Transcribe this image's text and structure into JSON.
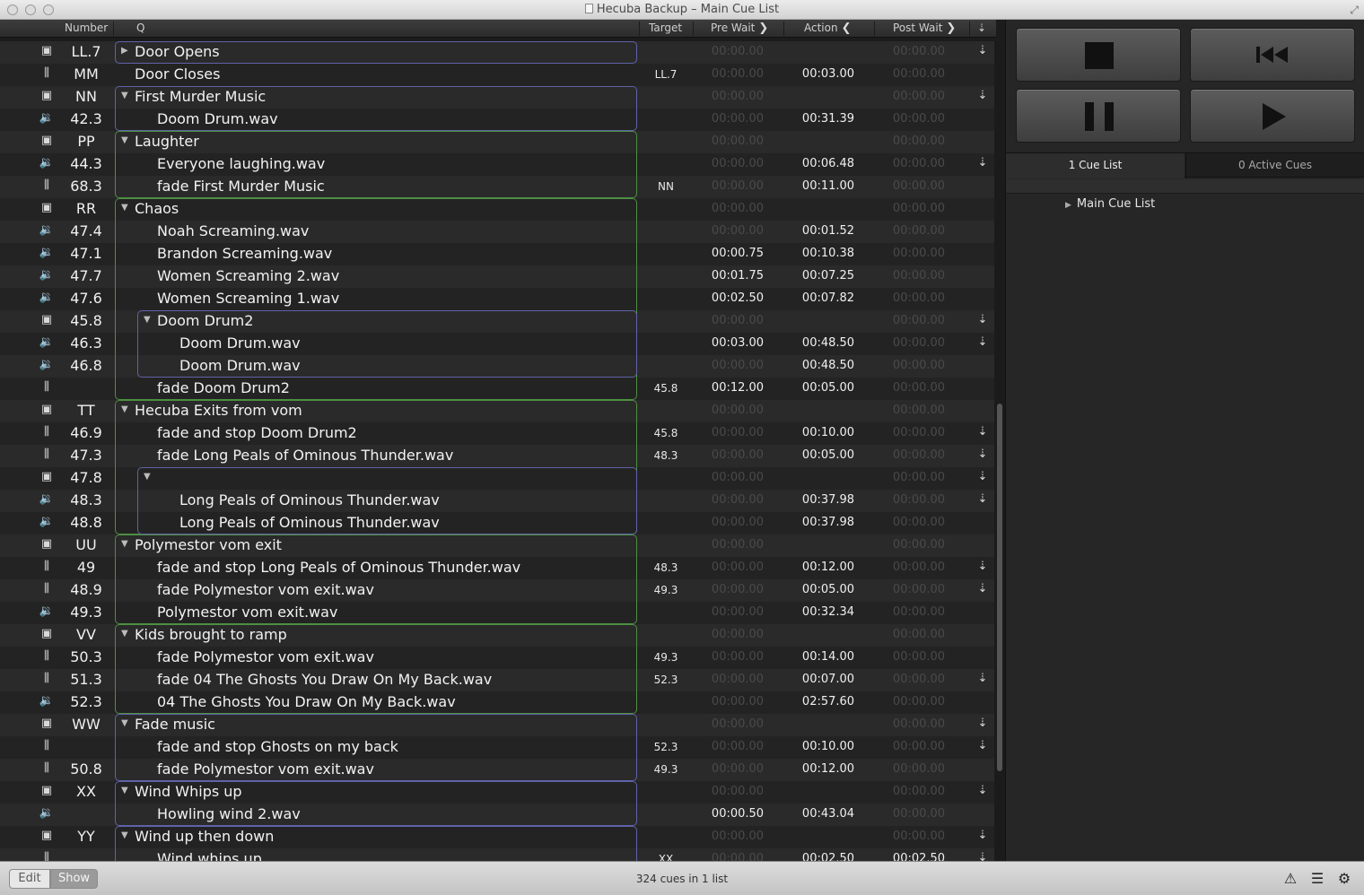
{
  "window": {
    "title": "Hecuba Backup – Main Cue List"
  },
  "columns": {
    "number": "Number",
    "q": "Q",
    "target": "Target",
    "pre_wait": "Pre Wait",
    "action": "Action",
    "post_wait": "Post Wait"
  },
  "rows": [
    {
      "type": "group",
      "num": "LL.7",
      "indent": 0,
      "tri": "collapsed",
      "name": "Door Opens",
      "target": "",
      "pre": "00:00.00",
      "pre_lit": false,
      "action": "",
      "post": "00:00.00",
      "cont": true
    },
    {
      "type": "fade",
      "num": "MM",
      "indent": 0,
      "tri": "",
      "name": "Door Closes",
      "target": "LL.7",
      "pre": "00:00.00",
      "pre_lit": false,
      "action": "00:03.00",
      "post": "00:00.00",
      "cont": false
    },
    {
      "type": "group",
      "num": "NN",
      "indent": 0,
      "tri": "open",
      "name": "First Murder Music",
      "target": "",
      "pre": "00:00.00",
      "pre_lit": false,
      "action": "",
      "post": "00:00.00",
      "cont": true
    },
    {
      "type": "audio",
      "num": "42.3",
      "indent": 1,
      "tri": "",
      "name": "Doom Drum.wav",
      "target": "",
      "pre": "00:00.00",
      "pre_lit": false,
      "action": "00:31.39",
      "post": "00:00.00",
      "cont": false
    },
    {
      "type": "group",
      "num": "PP",
      "indent": 0,
      "tri": "open",
      "name": "Laughter",
      "target": "",
      "pre": "00:00.00",
      "pre_lit": false,
      "action": "",
      "post": "00:00.00",
      "cont": false
    },
    {
      "type": "audio",
      "num": "44.3",
      "indent": 1,
      "tri": "",
      "name": "Everyone laughing.wav",
      "target": "",
      "pre": "00:00.00",
      "pre_lit": false,
      "action": "00:06.48",
      "post": "00:00.00",
      "cont": true
    },
    {
      "type": "fade",
      "num": "68.3",
      "indent": 1,
      "tri": "",
      "name": "fade First Murder Music",
      "target": "NN",
      "pre": "00:00.00",
      "pre_lit": false,
      "action": "00:11.00",
      "post": "00:00.00",
      "cont": false
    },
    {
      "type": "group",
      "num": "RR",
      "indent": 0,
      "tri": "open",
      "name": "Chaos",
      "target": "",
      "pre": "00:00.00",
      "pre_lit": false,
      "action": "",
      "post": "00:00.00",
      "cont": false
    },
    {
      "type": "audio",
      "num": "47.4",
      "indent": 1,
      "tri": "",
      "name": "Noah Screaming.wav",
      "target": "",
      "pre": "00:00.00",
      "pre_lit": false,
      "action": "00:01.52",
      "post": "00:00.00",
      "cont": false
    },
    {
      "type": "audio",
      "num": "47.1",
      "indent": 1,
      "tri": "",
      "name": "Brandon Screaming.wav",
      "target": "",
      "pre": "00:00.75",
      "pre_lit": true,
      "action": "00:10.38",
      "post": "00:00.00",
      "cont": false
    },
    {
      "type": "audio",
      "num": "47.7",
      "indent": 1,
      "tri": "",
      "name": "Women Screaming 2.wav",
      "target": "",
      "pre": "00:01.75",
      "pre_lit": true,
      "action": "00:07.25",
      "post": "00:00.00",
      "cont": false
    },
    {
      "type": "audio",
      "num": "47.6",
      "indent": 1,
      "tri": "",
      "name": "Women Screaming 1.wav",
      "target": "",
      "pre": "00:02.50",
      "pre_lit": true,
      "action": "00:07.82",
      "post": "00:00.00",
      "cont": false
    },
    {
      "type": "group",
      "num": "45.8",
      "indent": 1,
      "tri": "open",
      "name": "Doom Drum2",
      "target": "",
      "pre": "00:00.00",
      "pre_lit": false,
      "action": "",
      "post": "00:00.00",
      "cont": true
    },
    {
      "type": "audio",
      "num": "46.3",
      "indent": 2,
      "tri": "",
      "name": "Doom Drum.wav",
      "target": "",
      "pre": "00:03.00",
      "pre_lit": true,
      "action": "00:48.50",
      "post": "00:00.00",
      "cont": true
    },
    {
      "type": "audio",
      "num": "46.8",
      "indent": 2,
      "tri": "",
      "name": "Doom Drum.wav",
      "target": "",
      "pre": "00:00.00",
      "pre_lit": false,
      "action": "00:48.50",
      "post": "00:00.00",
      "cont": false
    },
    {
      "type": "fade",
      "num": "",
      "indent": 1,
      "tri": "",
      "name": "fade Doom Drum2",
      "target": "45.8",
      "pre": "00:12.00",
      "pre_lit": true,
      "action": "00:05.00",
      "post": "00:00.00",
      "cont": false
    },
    {
      "type": "group",
      "num": "TT",
      "indent": 0,
      "tri": "open",
      "name": "Hecuba Exits from vom",
      "target": "",
      "pre": "00:00.00",
      "pre_lit": false,
      "action": "",
      "post": "00:00.00",
      "cont": false
    },
    {
      "type": "fade",
      "num": "46.9",
      "indent": 1,
      "tri": "",
      "name": "fade and stop Doom Drum2",
      "target": "45.8",
      "pre": "00:00.00",
      "pre_lit": false,
      "action": "00:10.00",
      "post": "00:00.00",
      "cont": true
    },
    {
      "type": "fade",
      "num": "47.3",
      "indent": 1,
      "tri": "",
      "name": "fade Long Peals of Ominous Thunder.wav",
      "target": "48.3",
      "pre": "00:00.00",
      "pre_lit": false,
      "action": "00:05.00",
      "post": "00:00.00",
      "cont": true
    },
    {
      "type": "group",
      "num": "47.8",
      "indent": 1,
      "tri": "open",
      "name": "",
      "target": "",
      "pre": "00:00.00",
      "pre_lit": false,
      "action": "",
      "post": "00:00.00",
      "cont": true
    },
    {
      "type": "audio",
      "num": "48.3",
      "indent": 2,
      "tri": "",
      "name": "Long Peals of Ominous Thunder.wav",
      "target": "",
      "pre": "00:00.00",
      "pre_lit": false,
      "action": "00:37.98",
      "post": "00:00.00",
      "cont": true
    },
    {
      "type": "audio",
      "num": "48.8",
      "indent": 2,
      "tri": "",
      "name": "Long Peals of Ominous Thunder.wav",
      "target": "",
      "pre": "00:00.00",
      "pre_lit": false,
      "action": "00:37.98",
      "post": "00:00.00",
      "cont": false
    },
    {
      "type": "group",
      "num": "UU",
      "indent": 0,
      "tri": "open",
      "name": "Polymestor vom exit",
      "target": "",
      "pre": "00:00.00",
      "pre_lit": false,
      "action": "",
      "post": "00:00.00",
      "cont": false
    },
    {
      "type": "fade",
      "num": "49",
      "indent": 1,
      "tri": "",
      "name": "fade and stop Long Peals of Ominous Thunder.wav",
      "target": "48.3",
      "pre": "00:00.00",
      "pre_lit": false,
      "action": "00:12.00",
      "post": "00:00.00",
      "cont": true
    },
    {
      "type": "fade",
      "num": "48.9",
      "indent": 1,
      "tri": "",
      "name": "fade Polymestor vom exit.wav",
      "target": "49.3",
      "pre": "00:00.00",
      "pre_lit": false,
      "action": "00:05.00",
      "post": "00:00.00",
      "cont": true
    },
    {
      "type": "audio",
      "num": "49.3",
      "indent": 1,
      "tri": "",
      "name": "Polymestor vom exit.wav",
      "target": "",
      "pre": "00:00.00",
      "pre_lit": false,
      "action": "00:32.34",
      "post": "00:00.00",
      "cont": false
    },
    {
      "type": "group",
      "num": "VV",
      "indent": 0,
      "tri": "open",
      "name": "Kids brought to ramp",
      "target": "",
      "pre": "00:00.00",
      "pre_lit": false,
      "action": "",
      "post": "00:00.00",
      "cont": false
    },
    {
      "type": "fade",
      "num": "50.3",
      "indent": 1,
      "tri": "",
      "name": "fade Polymestor vom exit.wav",
      "target": "49.3",
      "pre": "00:00.00",
      "pre_lit": false,
      "action": "00:14.00",
      "post": "00:00.00",
      "cont": false
    },
    {
      "type": "fade",
      "num": "51.3",
      "indent": 1,
      "tri": "",
      "name": "fade 04 The Ghosts You Draw On My Back.wav",
      "target": "52.3",
      "pre": "00:00.00",
      "pre_lit": false,
      "action": "00:07.00",
      "post": "00:00.00",
      "cont": true
    },
    {
      "type": "audio",
      "num": "52.3",
      "indent": 1,
      "tri": "",
      "name": "04 The Ghosts You Draw On My Back.wav",
      "target": "",
      "pre": "00:00.00",
      "pre_lit": false,
      "action": "02:57.60",
      "post": "00:00.00",
      "cont": false
    },
    {
      "type": "group",
      "num": "WW",
      "indent": 0,
      "tri": "open",
      "name": "Fade music",
      "target": "",
      "pre": "00:00.00",
      "pre_lit": false,
      "action": "",
      "post": "00:00.00",
      "cont": true
    },
    {
      "type": "fade",
      "num": "",
      "indent": 1,
      "tri": "",
      "name": "fade and stop Ghosts on my back",
      "target": "52.3",
      "pre": "00:00.00",
      "pre_lit": false,
      "action": "00:10.00",
      "post": "00:00.00",
      "cont": true
    },
    {
      "type": "fade",
      "num": "50.8",
      "indent": 1,
      "tri": "",
      "name": "fade Polymestor vom exit.wav",
      "target": "49.3",
      "pre": "00:00.00",
      "pre_lit": false,
      "action": "00:12.00",
      "post": "00:00.00",
      "cont": false
    },
    {
      "type": "group",
      "num": "XX",
      "indent": 0,
      "tri": "open",
      "name": "Wind Whips up",
      "target": "",
      "pre": "00:00.00",
      "pre_lit": false,
      "action": "",
      "post": "00:00.00",
      "cont": true
    },
    {
      "type": "audio",
      "num": "",
      "indent": 1,
      "tri": "",
      "name": "Howling wind 2.wav",
      "target": "",
      "pre": "00:00.50",
      "pre_lit": true,
      "action": "00:43.04",
      "post": "00:00.00",
      "cont": false
    },
    {
      "type": "group",
      "num": "YY",
      "indent": 0,
      "tri": "open",
      "name": "Wind up then down",
      "target": "",
      "pre": "00:00.00",
      "pre_lit": false,
      "action": "",
      "post": "00:00.00",
      "cont": true
    },
    {
      "type": "fade",
      "num": "",
      "indent": 1,
      "tri": "",
      "name": "Wind whips up",
      "target": "XX",
      "pre": "00:00.00",
      "pre_lit": false,
      "action": "00:02.50",
      "post": "00:02.50",
      "post_lit": true,
      "cont": true
    }
  ],
  "groups": [
    {
      "start": 0,
      "end": 0,
      "indent": 0,
      "color": "blue"
    },
    {
      "start": 2,
      "end": 3,
      "indent": 0,
      "color": "blue"
    },
    {
      "start": 4,
      "end": 6,
      "indent": 0,
      "color": "green"
    },
    {
      "start": 7,
      "end": 15,
      "indent": 0,
      "color": "green"
    },
    {
      "start": 12,
      "end": 14,
      "indent": 1,
      "color": "blue"
    },
    {
      "start": 16,
      "end": 21,
      "indent": 0,
      "color": "green"
    },
    {
      "start": 19,
      "end": 21,
      "indent": 1,
      "color": "blue"
    },
    {
      "start": 22,
      "end": 25,
      "indent": 0,
      "color": "green"
    },
    {
      "start": 26,
      "end": 29,
      "indent": 0,
      "color": "green"
    },
    {
      "start": 30,
      "end": 32,
      "indent": 0,
      "color": "blue"
    },
    {
      "start": 33,
      "end": 34,
      "indent": 0,
      "color": "blue"
    },
    {
      "start": 35,
      "end": 36,
      "indent": 0,
      "color": "blue"
    }
  ],
  "transport": {
    "stop_icon": "stop-icon",
    "rewind_icon": "skip-back-icon",
    "pause_icon": "pause-icon",
    "go_icon": "play-icon"
  },
  "sidebar": {
    "tab_cue_lists": "1 Cue List",
    "tab_active_cues": "0 Active Cues",
    "list_item": "Main Cue List"
  },
  "status": {
    "edit_label": "Edit",
    "show_label": "Show",
    "cue_count": "324 cues in 1 list"
  },
  "colors": {
    "group_blue": "#5f63a8",
    "group_green": "#4e8f42"
  }
}
